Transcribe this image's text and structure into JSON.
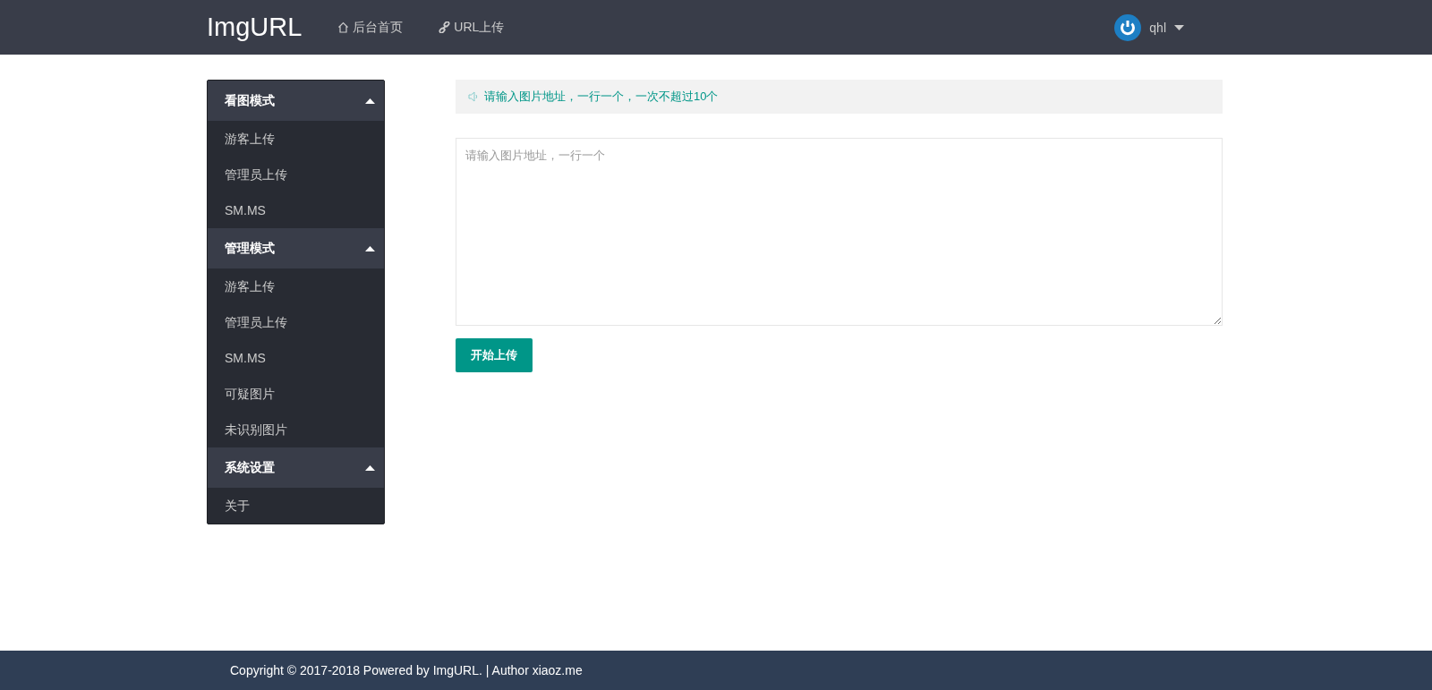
{
  "header": {
    "logo": "ImgURL",
    "nav": [
      {
        "kind": "home",
        "label": "后台首页"
      },
      {
        "kind": "link",
        "label": "URL上传"
      }
    ],
    "user": "qhl"
  },
  "sidebar": [
    {
      "title": "看图模式",
      "expanded": true,
      "items": [
        "游客上传",
        "管理员上传",
        "SM.MS"
      ]
    },
    {
      "title": "管理模式",
      "expanded": true,
      "items": [
        "游客上传",
        "管理员上传",
        "SM.MS",
        "可疑图片",
        "未识别图片"
      ]
    },
    {
      "title": "系统设置",
      "expanded": true,
      "items": [
        "关于"
      ]
    }
  ],
  "notice": "请输入图片地址，一行一个，一次不超过10个",
  "url_field": {
    "placeholder": "请输入图片地址，一行一个"
  },
  "upload_button": "开始上传",
  "footer": "Copyright © 2017-2018 Powered by ImgURL. | Author xiaoz.me"
}
